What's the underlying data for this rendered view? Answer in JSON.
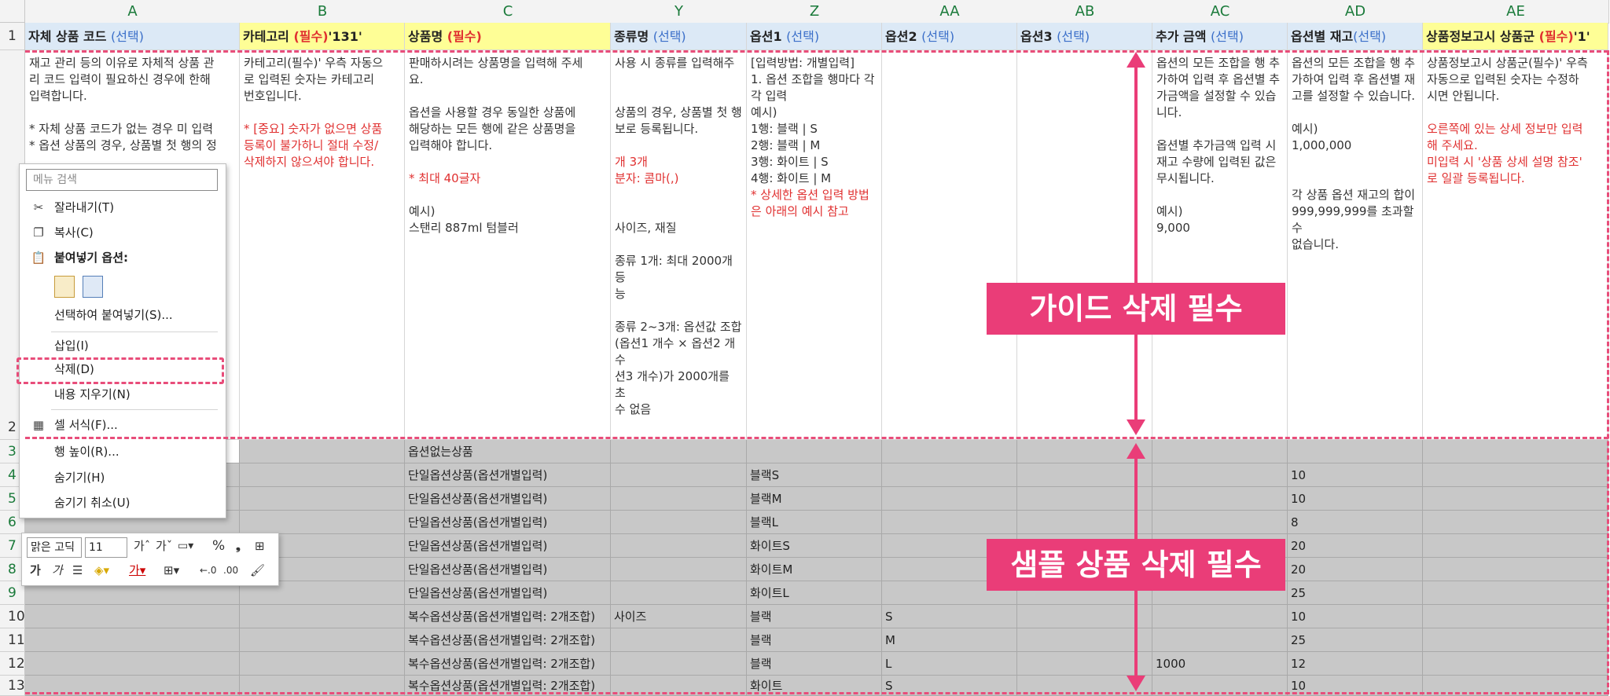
{
  "columns": [
    "A",
    "B",
    "C",
    "Y",
    "Z",
    "AA",
    "AB",
    "AC",
    "AD",
    "AE"
  ],
  "rows": [
    "1",
    "2",
    "3",
    "4",
    "5",
    "6",
    "7",
    "8",
    "9",
    "10",
    "11",
    "12",
    "13"
  ],
  "header": [
    {
      "title": "자체 상품 코드 ",
      "tag": "(선택)",
      "tagType": "opt",
      "suffix": ""
    },
    {
      "title": "카테고리 ",
      "tag": "(필수)",
      "tagType": "req",
      "suffix": "'131'"
    },
    {
      "title": "상품명 ",
      "tag": "(필수)",
      "tagType": "req",
      "suffix": ""
    },
    {
      "title": "종류명 ",
      "tag": "(선택)",
      "tagType": "opt",
      "suffix": ""
    },
    {
      "title": "옵션1 ",
      "tag": "(선택)",
      "tagType": "opt",
      "suffix": ""
    },
    {
      "title": "옵션2 ",
      "tag": "(선택)",
      "tagType": "opt",
      "suffix": ""
    },
    {
      "title": "옵션3 ",
      "tag": "(선택)",
      "tagType": "opt",
      "suffix": ""
    },
    {
      "title": "추가 금액 ",
      "tag": "(선택)",
      "tagType": "opt",
      "suffix": ""
    },
    {
      "title": "옵션별 재고",
      "tag": "(선택)",
      "tagType": "opt",
      "suffix": ""
    },
    {
      "title": "상품정보고시 상품군 ",
      "tag": "(필수)",
      "tagType": "req",
      "suffix": "'1'"
    }
  ],
  "guide": {
    "A": [
      {
        "t": "재고 관리 등의 이유로 자체적 상품 관\n리 코드 입력이 필요하신 경우에 한해\n입력합니다.\n\n* 자체 상품 코드가 없는 경우 미 입력\n* 옵션 상품의 경우, 상품별 첫 행의 정",
        "red": false
      }
    ],
    "B": [
      {
        "t": "카테고리(필수)' 우측 자동으\n로 입력된 숫자는 카테고리\n번호입니다.\n\n",
        "red": false
      },
      {
        "t": "* [중요] 숫자가 없으면 상품\n등록이 불가하니 절대 수정/\n삭제하지 않으셔야 합니다.",
        "red": true
      }
    ],
    "C": [
      {
        "t": "판매하시려는 상품명을 입력해 주세\n요.\n\n옵션을 사용할 경우 동일한 상품에\n해당하는 모든 행에 같은 상품명을\n입력해야 합니다.\n\n",
        "red": false
      },
      {
        "t": "* 최대 40글자",
        "red": true
      },
      {
        "t": "\n\n예시)\n스탠리 887ml 텀블러",
        "red": false
      }
    ],
    "Y": [
      {
        "t": "사용 시 종류를 입력해주\n\n\n상품의 경우, 상품별 첫 행\n보로 등록됩니다.\n\n",
        "red": false
      },
      {
        "t": "개 3개\n분자: 콤마(,)",
        "red": true
      },
      {
        "t": "\n\n\n 사이즈, 재질\n\n종류 1개: 최대 2000개 등\n능\n\n종류 2~3개: 옵션값 조합\n(옵션1 개수 × 옵션2 개수\n션3 개수)가 2000개를 초\n수 없음",
        "red": false
      }
    ],
    "Z": [
      {
        "t": "[입력방법: 개별입력]\n1. 옵션 조합을 행마다 각각 입력\n예시)\n1행: 블랙 | S\n2행: 블랙 | M\n3행: 화이트 | S\n4행: 화이트 | M\n",
        "red": false
      },
      {
        "t": "* 상세한 옵션 입력 방법은 아래의 예시 참고",
        "red": true
      }
    ],
    "AC": [
      {
        "t": "옵션의 모든 조합을 행 추\n가하여 입력 후 옵션별 추\n가금액을 설정할 수 있습\n니다.\n\n옵션별 추가금액 입력 시\n재고 수량에 입력된 값은\n무시됩니다.\n\n예시)\n9,000",
        "red": false
      }
    ],
    "AD": [
      {
        "t": "옵션의 모든 조합을 행 추\n가하여 입력 후 옵션별 재\n고를 설정할 수 있습니다.\n\n예시)\n1,000,000\n\n\n각 상품 옵션 재고의 합이\n999,999,999를 초과할 수\n없습니다.",
        "red": false
      }
    ],
    "AE": [
      {
        "t": "상품정보고시 상품군(필수)' 우측\n자동으로 입력된 숫자는 수정하\n시면 안됩니다.\n\n",
        "red": false
      },
      {
        "t": "오른쪽에 있는 상세 정보만 입력\n해 주세요.\n미입력 시 '상품 상세 설명 참조'\n로 일괄 등록됩니다.",
        "red": true
      }
    ]
  },
  "sample_rows": [
    {
      "C": "옵션없는상품",
      "Y": "",
      "Z": "",
      "AA": "",
      "AC": "",
      "AD": ""
    },
    {
      "C": "단일옵션상품(옵션개별입력)",
      "Y": "",
      "Z": "블랙S",
      "AA": "",
      "AC": "",
      "AD": "10"
    },
    {
      "C": "단일옵션상품(옵션개별입력)",
      "Y": "",
      "Z": "블랙M",
      "AA": "",
      "AC": "",
      "AD": "10"
    },
    {
      "C": "단일옵션상품(옵션개별입력)",
      "Y": "",
      "Z": "블랙L",
      "AA": "",
      "AC": "",
      "AD": "8"
    },
    {
      "C": "단일옵션상품(옵션개별입력)",
      "Y": "",
      "Z": "화이트S",
      "AA": "",
      "AC": "",
      "AD": "20"
    },
    {
      "C": "단일옵션상품(옵션개별입력)",
      "Y": "",
      "Z": "화이트M",
      "AA": "",
      "AC": "",
      "AD": "20"
    },
    {
      "C": "단일옵션상품(옵션개별입력)",
      "Y": "",
      "Z": "화이트L",
      "AA": "",
      "AC": "",
      "AD": "25"
    },
    {
      "C": "복수옵션상품(옵션개별입력: 2개조합)",
      "Y": "사이즈",
      "Z": "블랙",
      "AA": "S",
      "AC": "",
      "AD": "10"
    },
    {
      "C": "복수옵션상품(옵션개별입력: 2개조합)",
      "Y": "",
      "Z": "블랙",
      "AA": "M",
      "AC": "",
      "AD": "25"
    },
    {
      "C": "복수옵션상품(옵션개별입력: 2개조합)",
      "Y": "",
      "Z": "블랙",
      "AA": "L",
      "AC": "1000",
      "AD": "12"
    },
    {
      "C": "복수옵션상품(옵션개별입력: 2개조합)",
      "Y": "",
      "Z": "화이트",
      "AA": "S",
      "AC": "",
      "AD": "10"
    }
  ],
  "annotations": {
    "guide": "가이드 삭제 필수",
    "sample": "샘플 상품 삭제 필수"
  },
  "context_menu": {
    "search_placeholder": "메뉴 검색",
    "items": [
      {
        "label": "잘라내기(T)",
        "icon": "scissors-icon"
      },
      {
        "label": "복사(C)",
        "icon": "copy-icon"
      },
      {
        "label": "붙여넣기 옵션:",
        "icon": "paste-icon",
        "bold": true
      },
      {
        "label": "선택하여 붙여넣기(S)...",
        "icon": ""
      },
      {
        "label": "삽입(I)",
        "icon": ""
      },
      {
        "label": "삭제(D)",
        "icon": ""
      },
      {
        "label": "내용 지우기(N)",
        "icon": ""
      },
      {
        "label": "셀 서식(F)...",
        "icon": "format-cells-icon"
      },
      {
        "label": "행 높이(R)...",
        "icon": ""
      },
      {
        "label": "숨기기(H)",
        "icon": ""
      },
      {
        "label": "숨기기 취소(U)",
        "icon": ""
      }
    ]
  },
  "mini_toolbar": {
    "font": "맑은 고딕",
    "size": "11"
  },
  "colors": {
    "accent": "#ea3d78",
    "header_blue": "#dce9f6",
    "header_yellow": "#fefe96",
    "sample_gray": "#c8c8c8",
    "required_red": "#e03030",
    "optional_blue": "#3b6fc9"
  }
}
